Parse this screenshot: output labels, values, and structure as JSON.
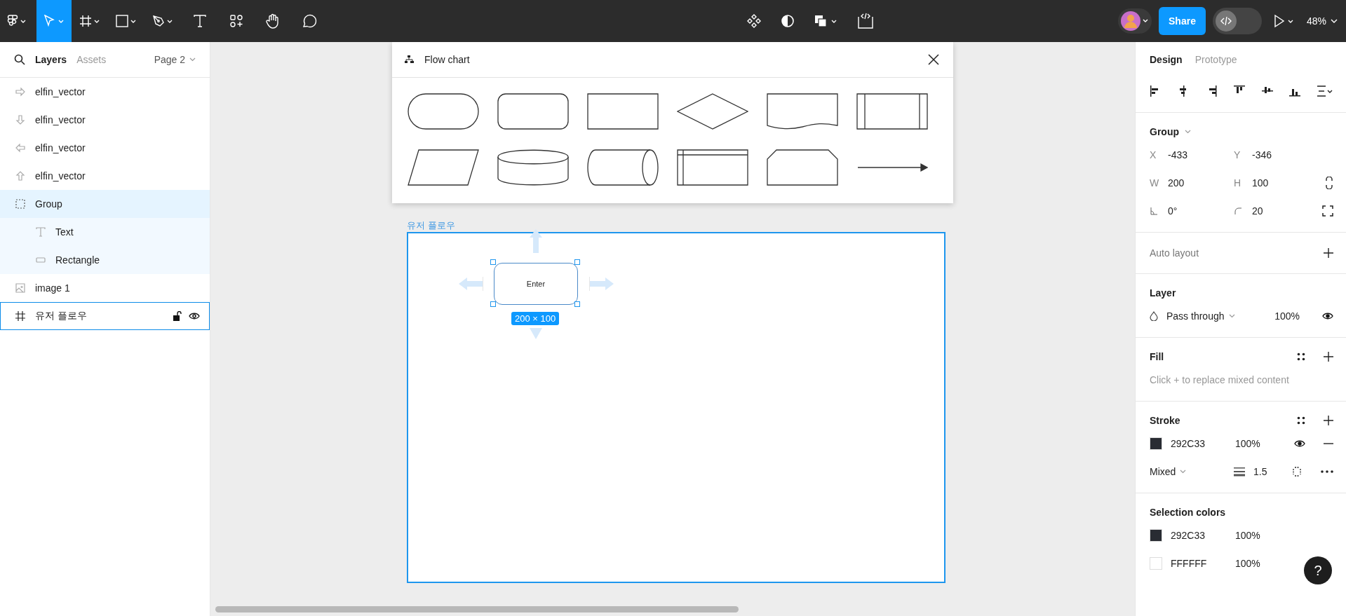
{
  "toolbar": {
    "tools": [
      {
        "kind": "menu",
        "selected": false
      },
      {
        "kind": "move",
        "selected": true
      },
      {
        "kind": "frame",
        "selected": false
      },
      {
        "kind": "shape",
        "selected": false
      },
      {
        "kind": "pen",
        "selected": false
      },
      {
        "kind": "text",
        "selected": false
      },
      {
        "kind": "resources",
        "selected": false
      },
      {
        "kind": "hand",
        "selected": false
      },
      {
        "kind": "comment",
        "selected": false
      }
    ],
    "center_tools": [
      {
        "kind": "component"
      },
      {
        "kind": "mask"
      },
      {
        "kind": "boolean"
      },
      {
        "kind": "dev"
      }
    ],
    "share_button": "Share",
    "dev_mode_on": false,
    "zoom": "48%"
  },
  "left_panel": {
    "tabs": [
      {
        "label": "Layers",
        "selected": true
      },
      {
        "label": "Assets",
        "selected": false
      }
    ],
    "page": "Page 2",
    "layers": [
      {
        "name": "elfin_vector",
        "kind": "arrow-right",
        "selected": false,
        "hovered": false
      },
      {
        "name": "elfin_vector",
        "kind": "arrow-down",
        "selected": false,
        "hovered": false
      },
      {
        "name": "elfin_vector",
        "kind": "arrow-left",
        "selected": false,
        "hovered": false
      },
      {
        "name": "elfin_vector",
        "kind": "arrow-up",
        "selected": false,
        "hovered": false
      },
      {
        "name": "Group",
        "kind": "group",
        "selected": true,
        "hovered": false,
        "children": [
          {
            "name": "Text",
            "kind": "text",
            "selected": false,
            "hovered": false
          },
          {
            "name": "Rectangle",
            "kind": "rectangle",
            "selected": false,
            "hovered": false
          }
        ]
      },
      {
        "name": "image 1",
        "kind": "image",
        "selected": false,
        "hovered": false
      },
      {
        "name": "유저 플로우",
        "kind": "frame",
        "selected": false,
        "hovered": true
      }
    ]
  },
  "flowchart_panel": {
    "title": "Flow chart",
    "shapes": [
      {
        "kind": "pill"
      },
      {
        "kind": "rounded"
      },
      {
        "kind": "rect"
      },
      {
        "kind": "diamond"
      },
      {
        "kind": "document"
      },
      {
        "kind": "predefined"
      },
      {
        "kind": "parallelogram"
      },
      {
        "kind": "disk"
      },
      {
        "kind": "cylinder"
      },
      {
        "kind": "storage"
      },
      {
        "kind": "clipped"
      },
      {
        "kind": "arrow"
      }
    ]
  },
  "canvas": {
    "frame": {
      "label": "유저 플로우",
      "hovered": true
    },
    "node": {
      "text": "Enter",
      "selected": true,
      "size": "200 × 100"
    }
  },
  "right_panel": {
    "tabs": [
      {
        "label": "Design",
        "selected": true
      },
      {
        "label": "Prototype",
        "selected": false
      }
    ],
    "group": {
      "title": "Group",
      "fields": [
        {
          "label": "X",
          "value": "-433"
        },
        {
          "label": "Y",
          "value": "-346"
        },
        {
          "label": "W",
          "value": "200"
        },
        {
          "label": "H",
          "value": "100"
        },
        {
          "kind": "angle",
          "value": "0°"
        },
        {
          "kind": "corner",
          "value": "20"
        }
      ]
    },
    "auto_layout": "Auto layout",
    "layer": {
      "title": "Layer",
      "blend": "Pass through",
      "opacity": "100%"
    },
    "fill": {
      "title": "Fill",
      "hint": "Click + to replace mixed content"
    },
    "stroke": {
      "title": "Stroke",
      "color": "#292c33",
      "hex": "292C33",
      "opacity": "100%",
      "position": "Mixed",
      "weight": "1.5"
    },
    "selection_colors": {
      "title": "Selection colors",
      "items": [
        {
          "hex": "292C33",
          "opacity": "100%",
          "color": "#292c33"
        },
        {
          "hex": "FFFFFF",
          "opacity": "100%",
          "color": "#ffffff"
        }
      ]
    },
    "help": "?"
  }
}
